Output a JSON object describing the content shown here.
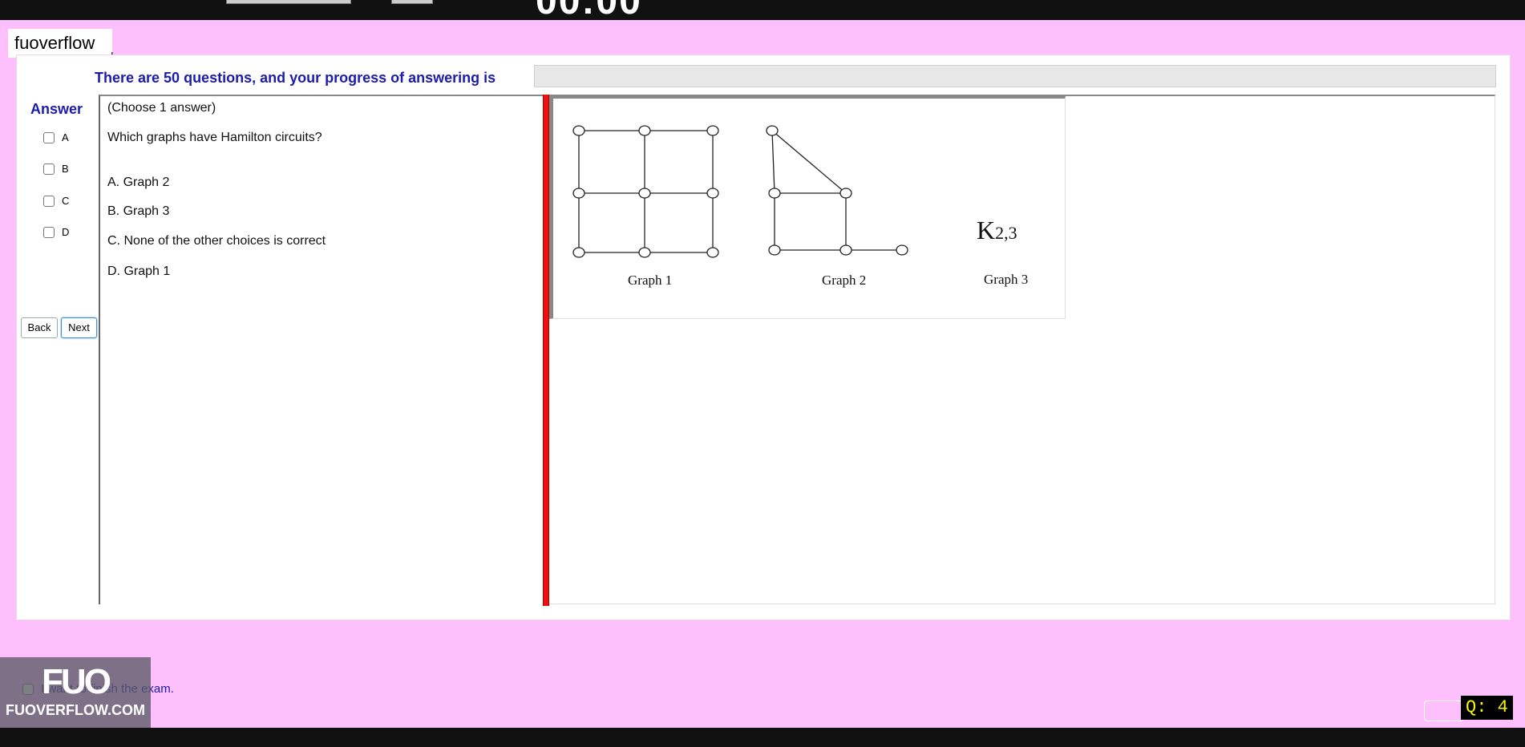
{
  "brand_tab": "fuoverflow",
  "progress": {
    "text": "There are 50 questions, and your progress of answering is"
  },
  "answer": {
    "title": "Answer",
    "options": [
      "A",
      "B",
      "C",
      "D"
    ]
  },
  "nav": {
    "back": "Back",
    "next": "Next"
  },
  "question": {
    "instruction": "(Choose 1 answer)",
    "text": "Which graphs have Hamilton circuits?",
    "choices": [
      "A.  Graph 2",
      "B.  Graph 3",
      "C.  None of the other choices is correct",
      "D.  Graph 1"
    ]
  },
  "figure": {
    "graph1_label": "Graph 1",
    "graph2_label": "Graph  2",
    "graph3_label": "Graph  3",
    "graph3_symbol": "K",
    "graph3_sub": "2,3"
  },
  "finish_text": "I want to finish the exam.",
  "logo": {
    "big": "FUO",
    "small": "FUOVERFLOW.COM"
  },
  "question_counter": "Q: 4"
}
